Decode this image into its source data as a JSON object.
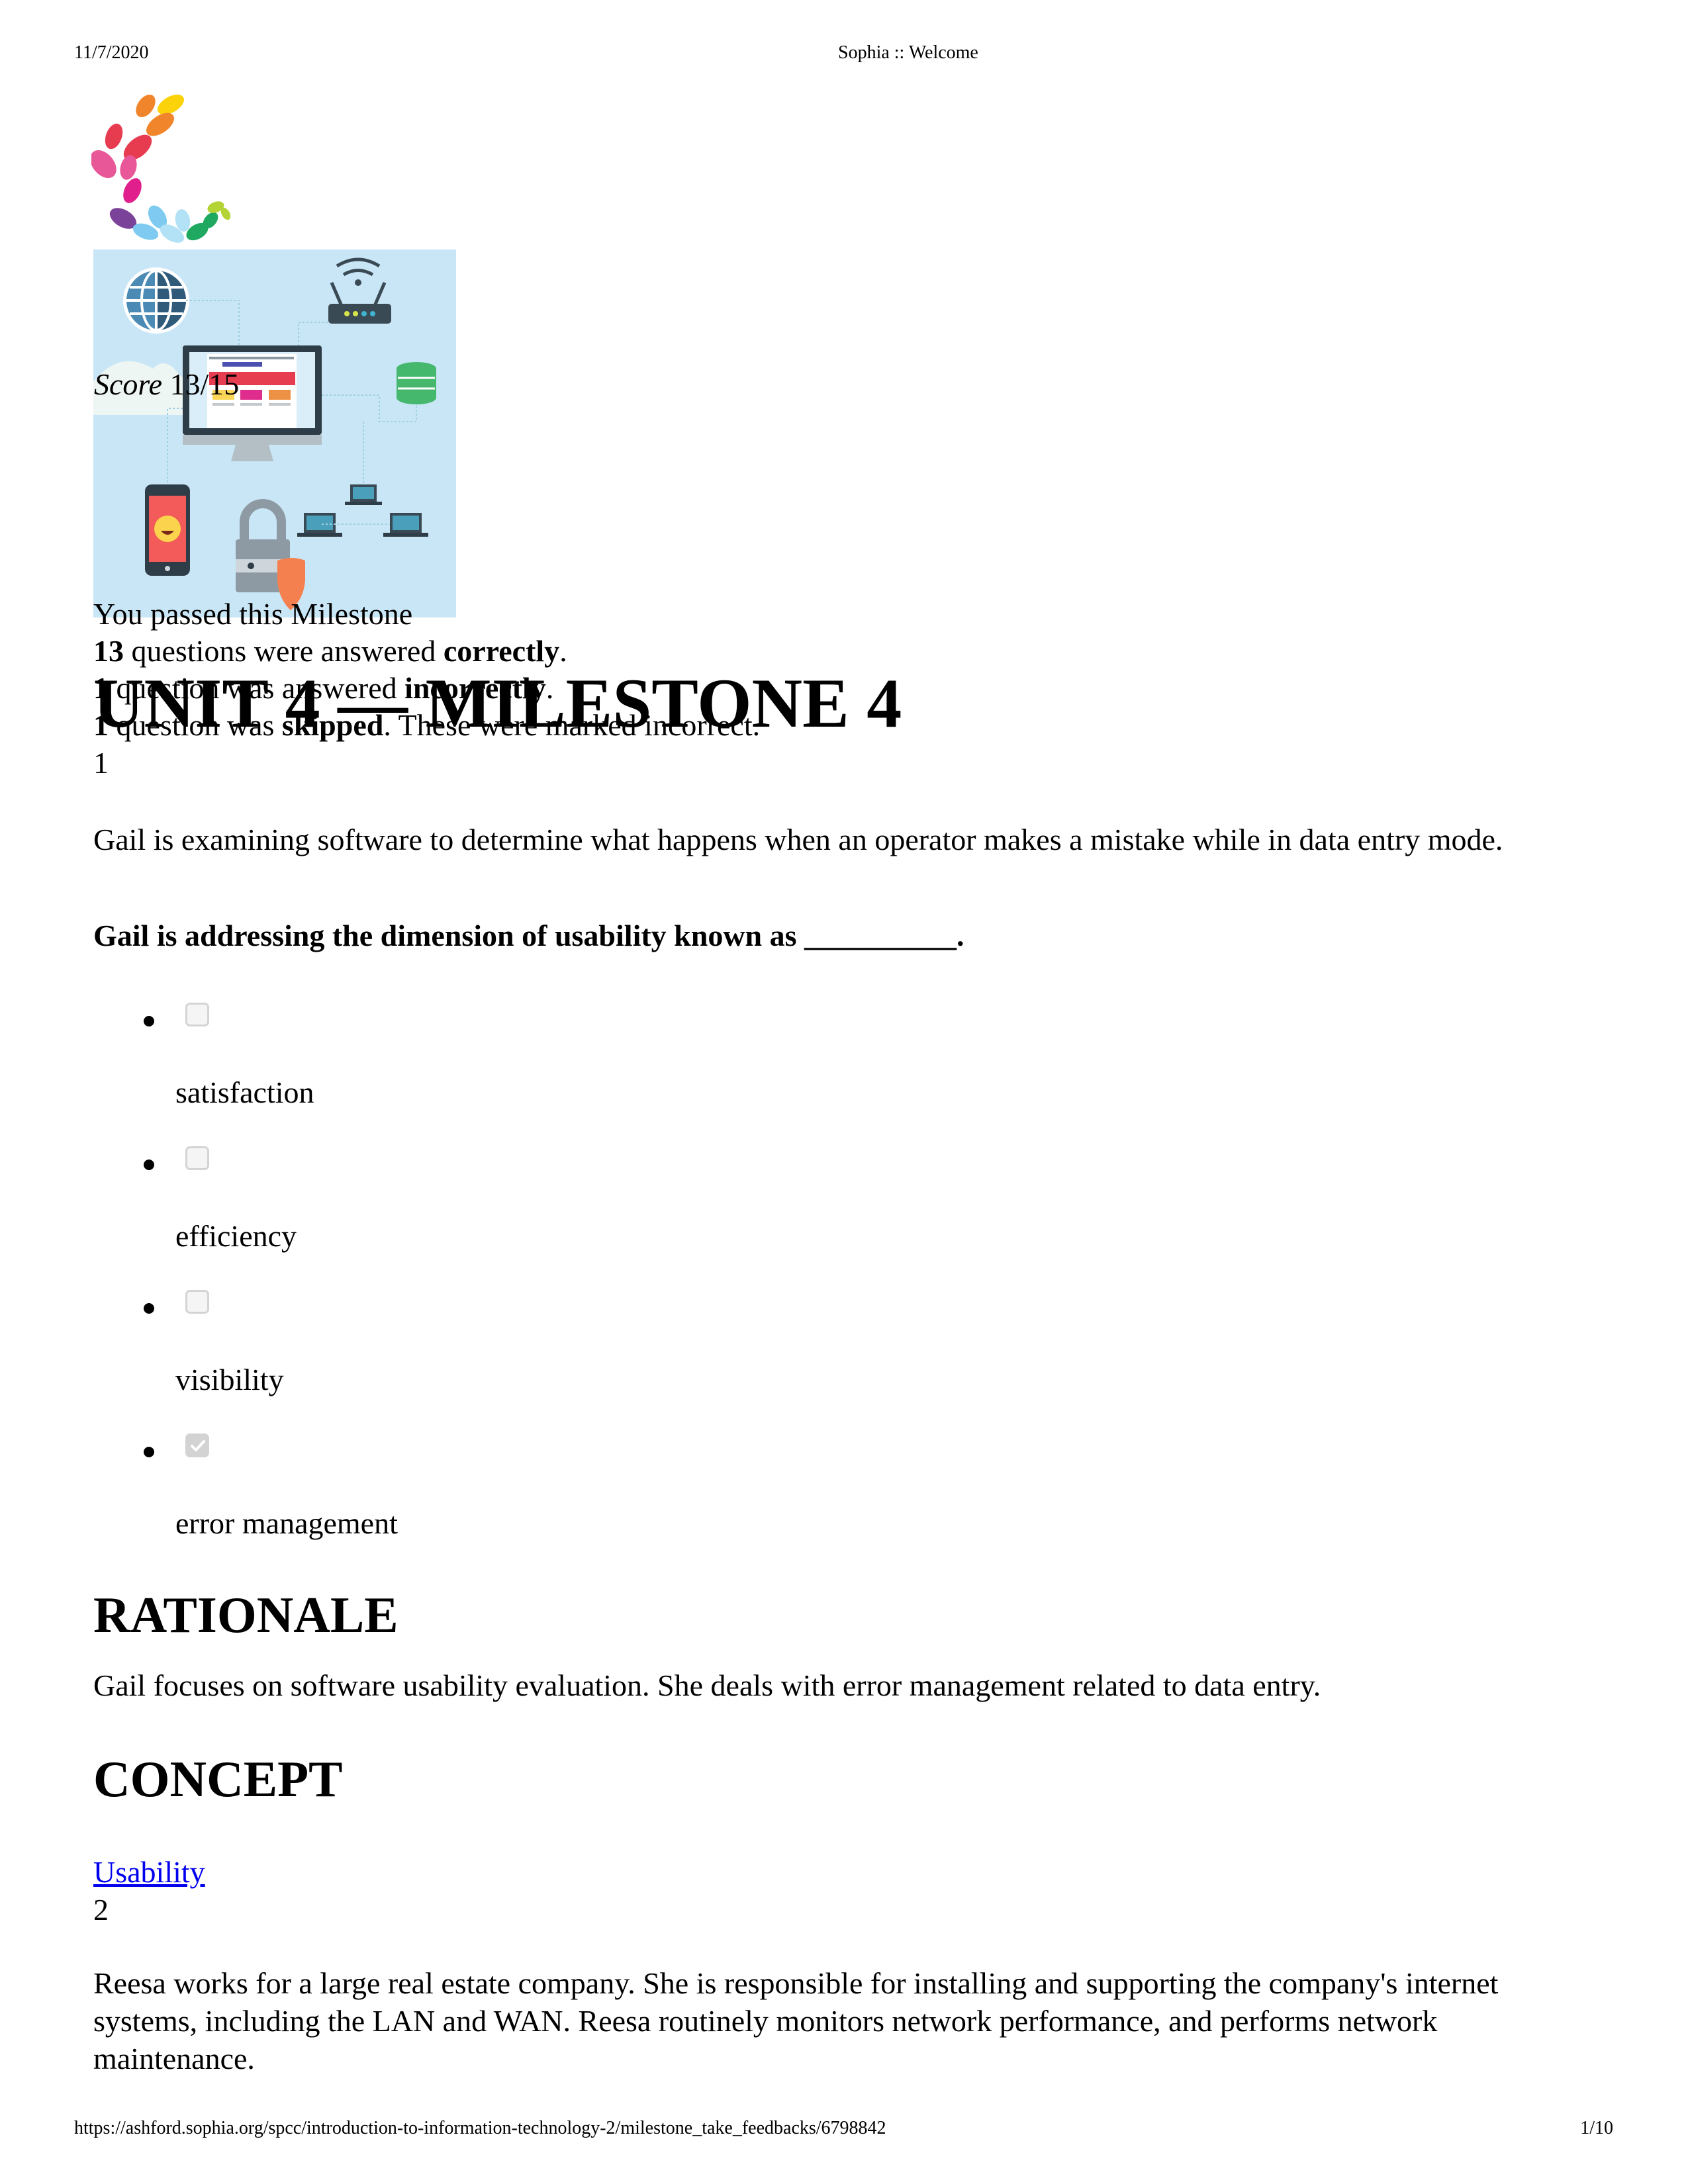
{
  "print_header": {
    "date": "11/7/2020",
    "page_title": "Sophia :: Welcome"
  },
  "print_footer": {
    "url": "https://ashford.sophia.org/spcc/introduction-to-information-technology-2/milestone_take_feedbacks/6798842",
    "page_number": "1/10"
  },
  "brand": {
    "logo_icon": "sophia-leaf-logo-icon",
    "logo_colors": [
      "#f0852c",
      "#fcd20a",
      "#e73c50",
      "#e85899",
      "#e01f8c",
      "#7b4299",
      "#7ecaf0",
      "#b3e1f6",
      "#1fa85f",
      "#b4d334"
    ]
  },
  "hero_image": {
    "icon": "it-network-illustration-icon",
    "background": "#c9e6f7"
  },
  "score": {
    "label": "Score",
    "value": "13/15"
  },
  "summary": {
    "passed_message": "You passed this Milestone",
    "correct_count": "13",
    "correct_text_pre": " questions were answered ",
    "correct_word": "correctly",
    "correct_text_post": ".",
    "incorrect_count": "1",
    "incorrect_text_pre": " question was answered ",
    "incorrect_word": "incorrectly",
    "incorrect_text_post": ".",
    "skipped_count": "1",
    "skipped_text_pre": " question was ",
    "skipped_word": "skipped",
    "skipped_text_post": ". These were marked incorrect."
  },
  "page": {
    "title": "UNIT 4 — MILESTONE 4"
  },
  "questions": [
    {
      "number": "1",
      "text": "Gail is examining software to determine what happens when an operator makes a mistake while in data entry mode.",
      "prompt": "Gail is addressing the dimension of usability known as __________.",
      "options": [
        {
          "label": "satisfaction",
          "checked": false
        },
        {
          "label": "efficiency",
          "checked": false
        },
        {
          "label": "visibility",
          "checked": false
        },
        {
          "label": "error management",
          "checked": true
        }
      ],
      "rationale_heading": "RATIONALE",
      "rationale": "Gail focuses on software usability evaluation. She deals with error management related to data entry.",
      "concept_heading": "CONCEPT",
      "concept_link": "Usability"
    },
    {
      "number": "2",
      "text": "Reesa works for a large real estate company. She is responsible for installing and supporting the company's internet systems, including the LAN and WAN. Reesa routinely monitors network performance, and performs network maintenance."
    }
  ],
  "colors": {
    "link": "#0000ee",
    "checkbox_border": "#d4d4d4",
    "checkbox_checked": "#d3d3d3"
  }
}
